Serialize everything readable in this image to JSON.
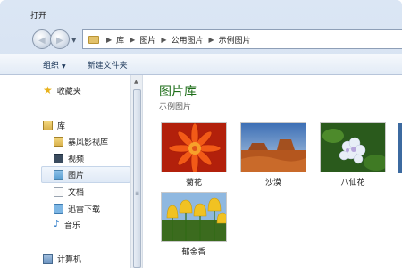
{
  "window": {
    "title": "打开"
  },
  "breadcrumb": [
    "库",
    "图片",
    "公用图片",
    "示例图片"
  ],
  "toolbar": {
    "organize_label": "组织",
    "new_folder_label": "新建文件夹"
  },
  "sidebar": {
    "favorites_label": "收藏夹",
    "library_label": "库",
    "items": [
      "暴风影视库",
      "视频",
      "图片",
      "文档",
      "迅雷下载",
      "音乐"
    ],
    "computer_label": "计算机"
  },
  "main": {
    "title": "图片库",
    "subtitle": "示例图片",
    "thumbnails": [
      {
        "label": "菊花",
        "icon": "chrysanthemum-photo"
      },
      {
        "label": "沙漠",
        "icon": "desert-photo"
      },
      {
        "label": "八仙花",
        "icon": "hydrangea-photo"
      },
      {
        "label": "郁金香",
        "icon": "tulips-photo"
      }
    ]
  },
  "colors": {
    "library_title": "#1e6e19",
    "selection": "#dfe9f6"
  }
}
